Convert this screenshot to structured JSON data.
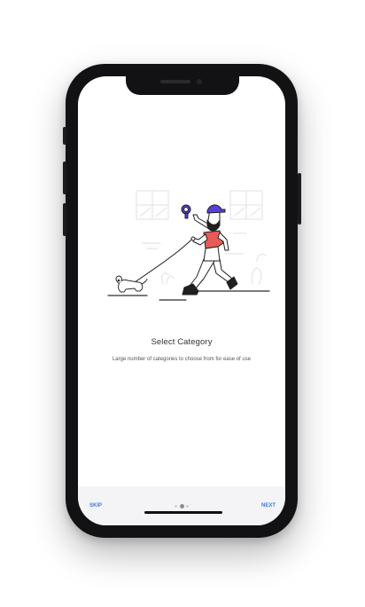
{
  "onboarding": {
    "title": "Select Category",
    "subtitle": "Large number of categories to choose from for ease of use",
    "illustration": "man-walking-dog-illustration"
  },
  "footer": {
    "skip_label": "SKIP",
    "next_label": "NEXT",
    "pagination": {
      "total": 3,
      "current": 2
    }
  },
  "colors": {
    "accent": "#3d7be0",
    "shirt": "#e85a57",
    "cap": "#5a3fd6",
    "phone_body": "#121214"
  }
}
